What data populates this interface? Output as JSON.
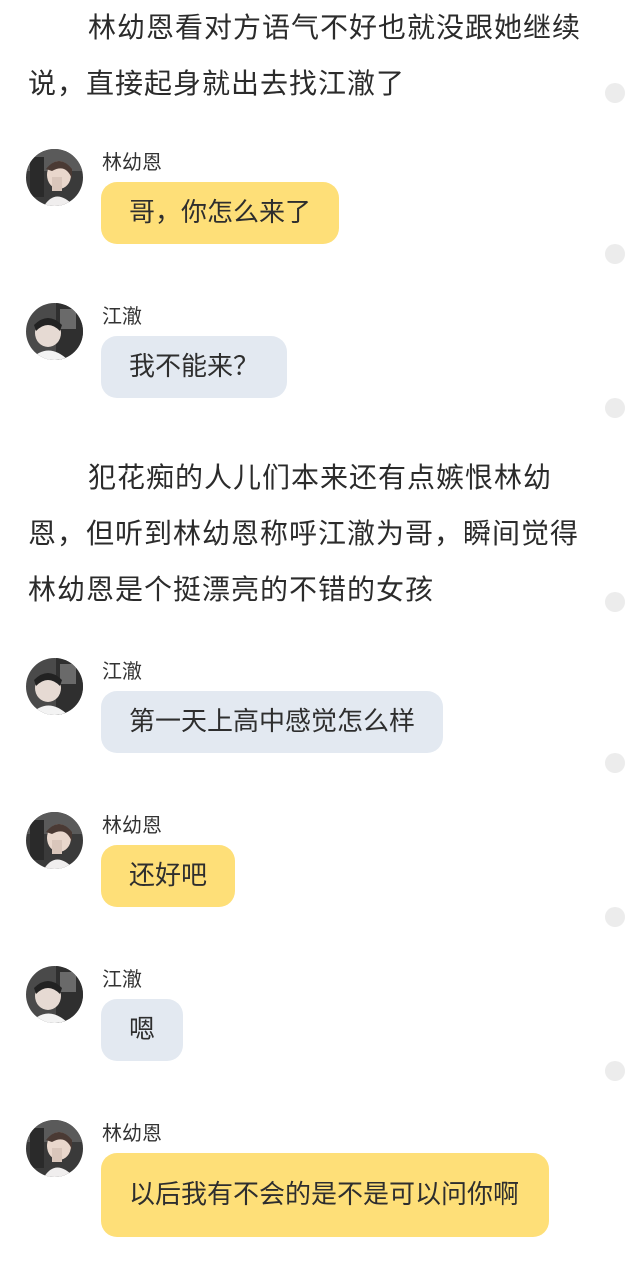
{
  "colors": {
    "self_bubble": "#fedf78",
    "other_bubble": "#e3e9f1",
    "text": "#2b2b2b",
    "side_dot": "#ececec"
  },
  "narration": [
    "林幼恩看对方语气不好也就没跟她继续说，直接起身就出去找江澈了",
    "犯花痴的人儿们本来还有点嫉恨林幼恩，但听到林幼恩称呼江澈为哥，瞬间觉得林幼恩是个挺漂亮的不错的女孩"
  ],
  "messages": [
    {
      "speaker": "林幼恩",
      "text": "哥，你怎么来了",
      "avatar": "lin-youen-avatar"
    },
    {
      "speaker": "江澈",
      "text": "我不能来？",
      "avatar": "jiang-che-avatar"
    },
    {
      "speaker": "江澈",
      "text": "第一天上高中感觉怎么样",
      "avatar": "jiang-che-avatar"
    },
    {
      "speaker": "林幼恩",
      "text": "还好吧",
      "avatar": "lin-youen-avatar"
    },
    {
      "speaker": "江澈",
      "text": "嗯",
      "avatar": "jiang-che-avatar"
    },
    {
      "speaker": "林幼恩",
      "text": "以后我有不会的是不是可以问你啊",
      "avatar": "lin-youen-avatar"
    }
  ]
}
